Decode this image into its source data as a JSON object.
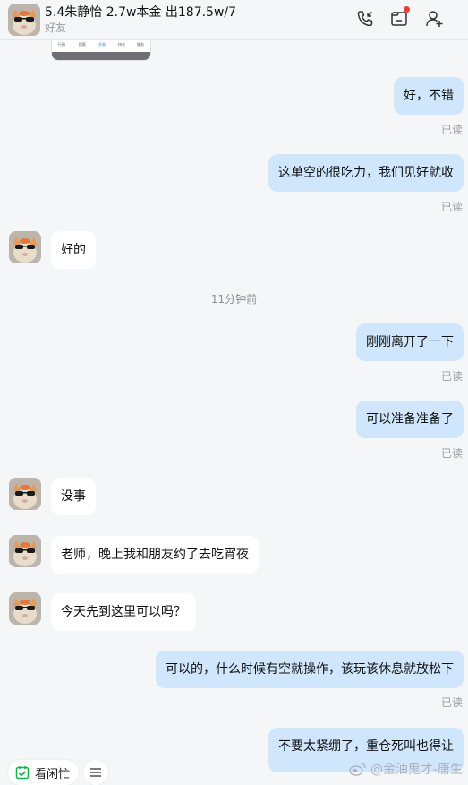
{
  "header": {
    "title": "5.4朱静怡 2.7w本金 出187.5w/7",
    "subtitle": "好友"
  },
  "image_fragment_tabs": [
    "行情",
    "搜索",
    "交易",
    "持仓",
    "服务"
  ],
  "messages": {
    "m1": "好，不错",
    "m2": "这单空的很吃力，我们见好就收",
    "m3": "好的",
    "m4": "刚刚离开了一下",
    "m5": "可以准备准备了",
    "m6": "没事",
    "m7": "老师，晚上我和朋友约了去吃宵夜",
    "m8": "今天先到这里可以吗？",
    "m9": "可以的，什么时候有空就操作，该玩该休息就放松下",
    "m10": "不要太紧绷了，重仓死叫也得让"
  },
  "read_label": "已读",
  "timestamp": "11分钟前",
  "bottom": {
    "pill_label": "看闲忙"
  },
  "watermark": "@金油鬼才-唐生",
  "colors": {
    "outgoing_bubble": "#cfe6fd",
    "incoming_bubble": "#ffffff",
    "background": "#f5f6f8",
    "notification_dot": "#f23c3c",
    "check_green": "#18b04a"
  }
}
